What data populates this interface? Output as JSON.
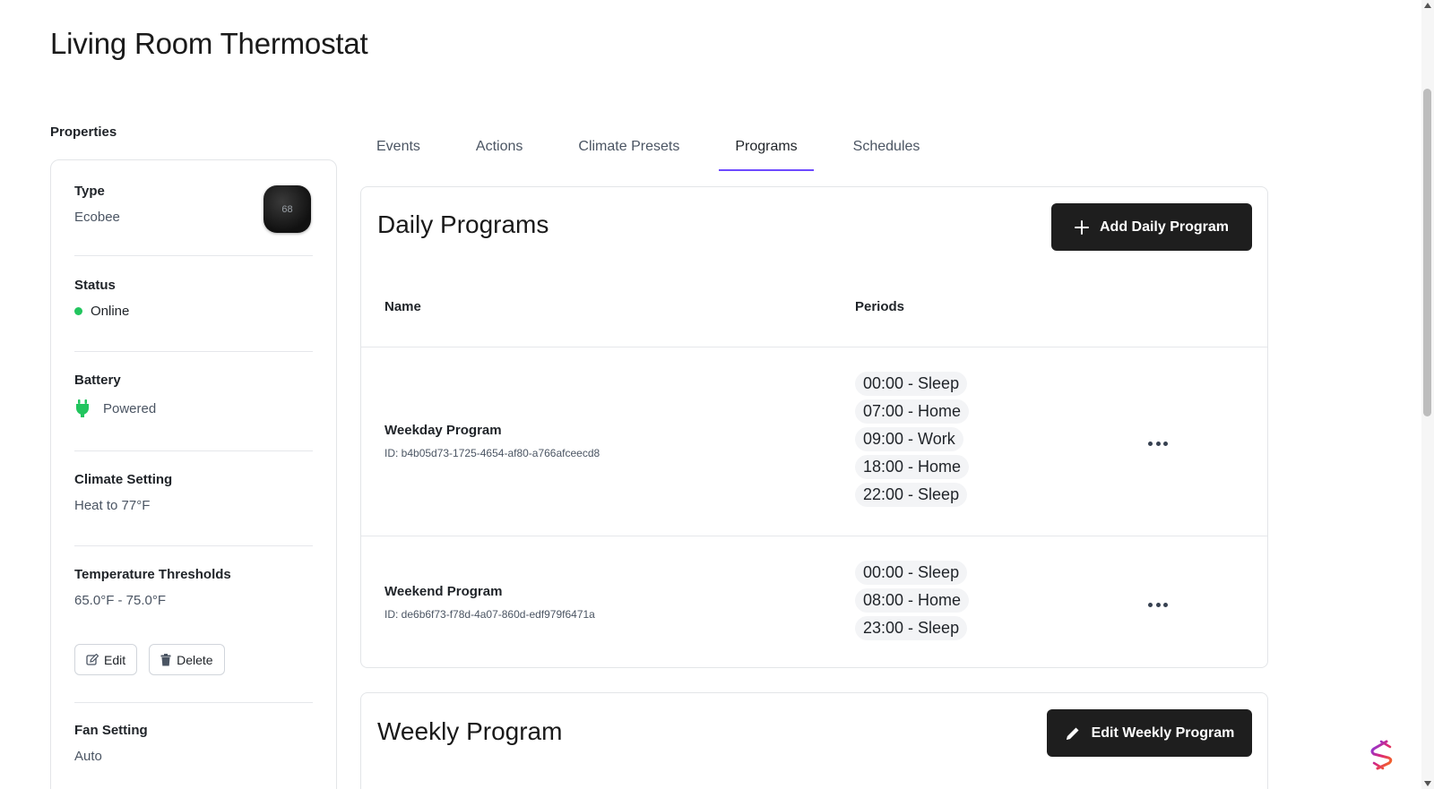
{
  "page": {
    "title": "Living Room Thermostat"
  },
  "properties": {
    "heading": "Properties",
    "type": {
      "label": "Type",
      "value": "Ecobee",
      "device_display": "68"
    },
    "status": {
      "label": "Status",
      "value": "Online",
      "color": "#22c55e"
    },
    "battery": {
      "label": "Battery",
      "value": "Powered",
      "icon": "plug-icon"
    },
    "climate": {
      "label": "Climate Setting",
      "value": "Heat to 77°F"
    },
    "thresholds": {
      "label": "Temperature Thresholds",
      "value": "65.0°F - 75.0°F"
    },
    "edit_label": "Edit",
    "delete_label": "Delete",
    "fan": {
      "label": "Fan Setting",
      "value": "Auto"
    }
  },
  "tabs": [
    {
      "label": "Events"
    },
    {
      "label": "Actions"
    },
    {
      "label": "Climate Presets"
    },
    {
      "label": "Programs",
      "active": true
    },
    {
      "label": "Schedules"
    }
  ],
  "daily": {
    "title": "Daily Programs",
    "add_label": "Add Daily Program",
    "columns": {
      "name": "Name",
      "periods": "Periods"
    },
    "programs": [
      {
        "name": "Weekday Program",
        "id": "ID: b4b05d73-1725-4654-af80-a766afceecd8",
        "periods": [
          "00:00 - Sleep",
          "07:00 - Home",
          "09:00 - Work",
          "18:00 - Home",
          "22:00 - Sleep"
        ]
      },
      {
        "name": "Weekend Program",
        "id": "ID: de6b6f73-f78d-4a07-860d-edf979f6471a",
        "periods": [
          "00:00 - Sleep",
          "08:00 - Home",
          "23:00 - Sleep"
        ]
      }
    ]
  },
  "weekly": {
    "title": "Weekly Program",
    "edit_label": "Edit Weekly Program"
  },
  "colors": {
    "accent": "#6d4aff",
    "dark_button": "#1e1e1e"
  }
}
